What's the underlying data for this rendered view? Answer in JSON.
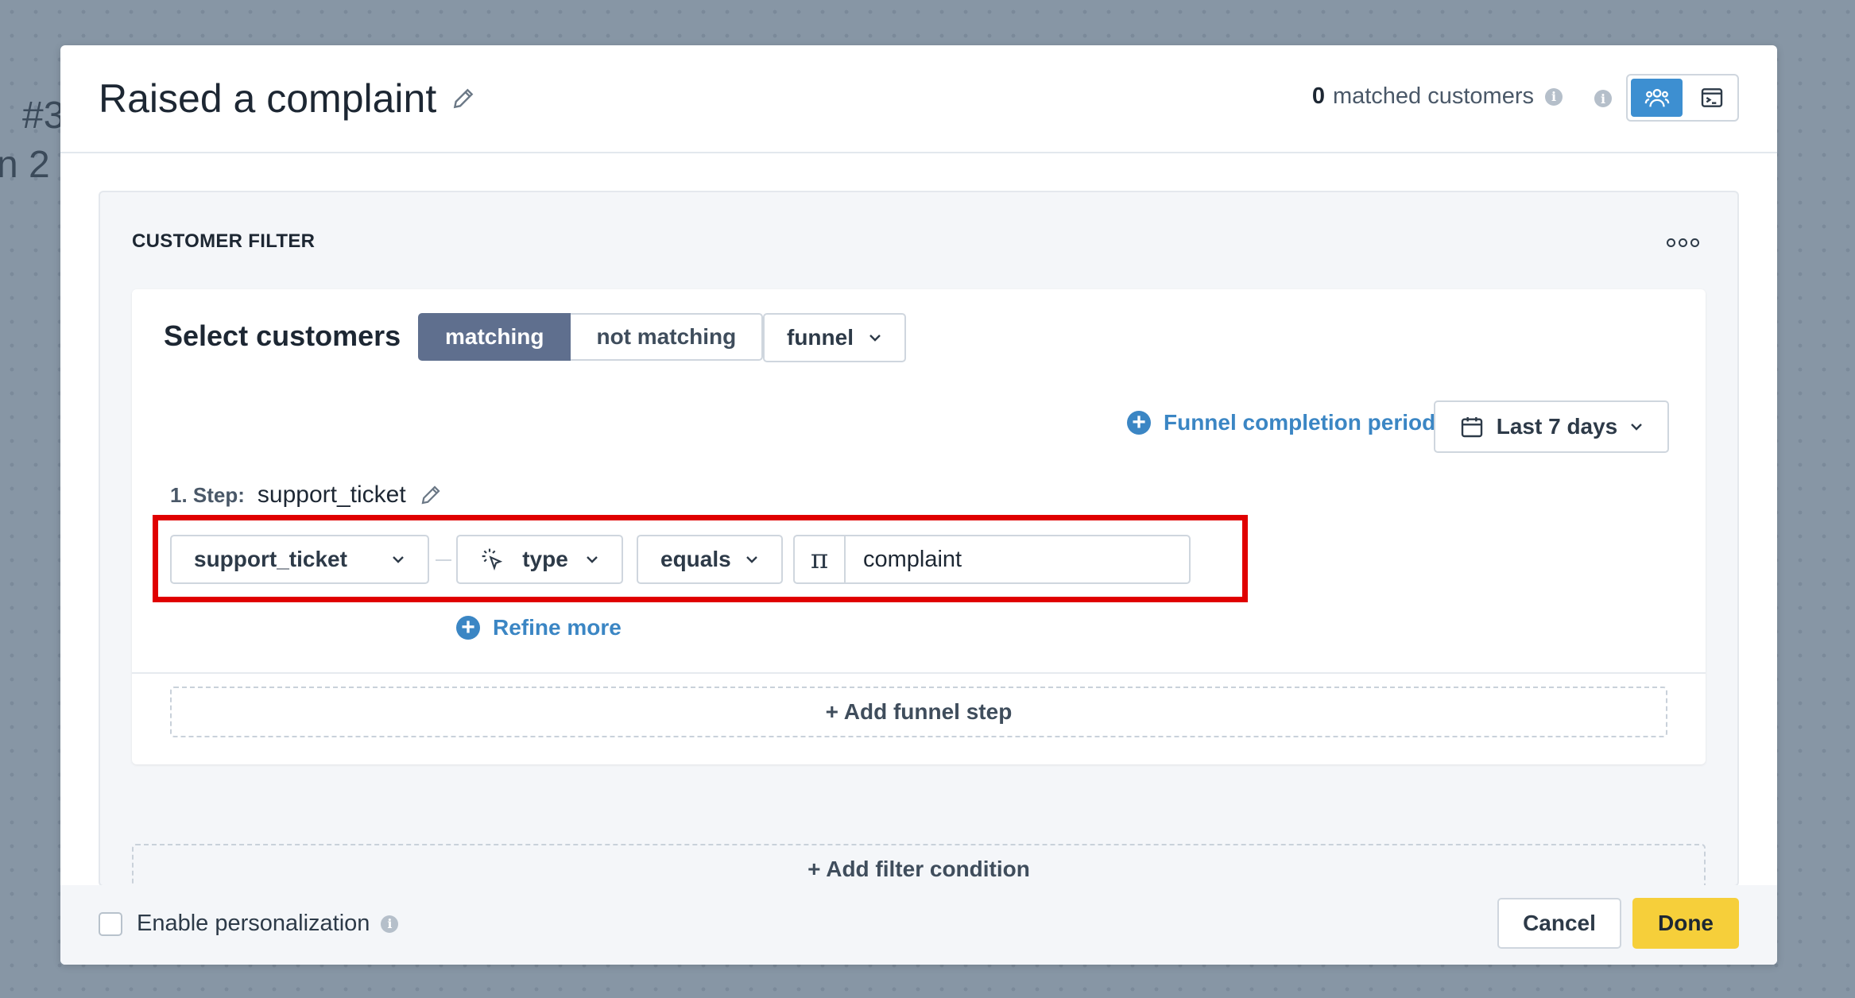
{
  "background": {
    "text_line1": "#3",
    "text_line2": "n 2"
  },
  "header": {
    "title": "Raised a complaint",
    "matched_count": "0",
    "matched_label": "matched customers"
  },
  "filter_panel": {
    "title": "CUSTOMER FILTER",
    "select_label": "Select customers",
    "segment": {
      "matching": "matching",
      "not_matching": "not matching",
      "selected": "matching"
    },
    "mode_dropdown": "funnel",
    "funnel_completion_label": "Funnel completion period",
    "period_dropdown": "Last 7 days",
    "step": {
      "number_label": "1. Step:",
      "name": "support_ticket",
      "event_dropdown": "support_ticket",
      "attribute_dropdown": "type",
      "operator_dropdown": "equals",
      "value": "complaint"
    },
    "refine_label": "Refine more",
    "add_step_label": "+ Add funnel step",
    "add_filter_label": "+ Add filter condition"
  },
  "footer": {
    "personalization_label": "Enable personalization",
    "personalization_checked": false,
    "cancel_label": "Cancel",
    "done_label": "Done"
  },
  "colors": {
    "accent": "#3b86c4",
    "segment_active": "#5f6f8e",
    "done": "#f6cf3a",
    "highlight": "#e00000"
  },
  "icons": [
    "edit-icon",
    "info-icon",
    "customers-view-icon",
    "terminal-view-icon",
    "more-icon",
    "calendar-icon",
    "chevron-down-icon",
    "pointer-click-icon",
    "text-type-icon",
    "plus-circle-icon"
  ]
}
